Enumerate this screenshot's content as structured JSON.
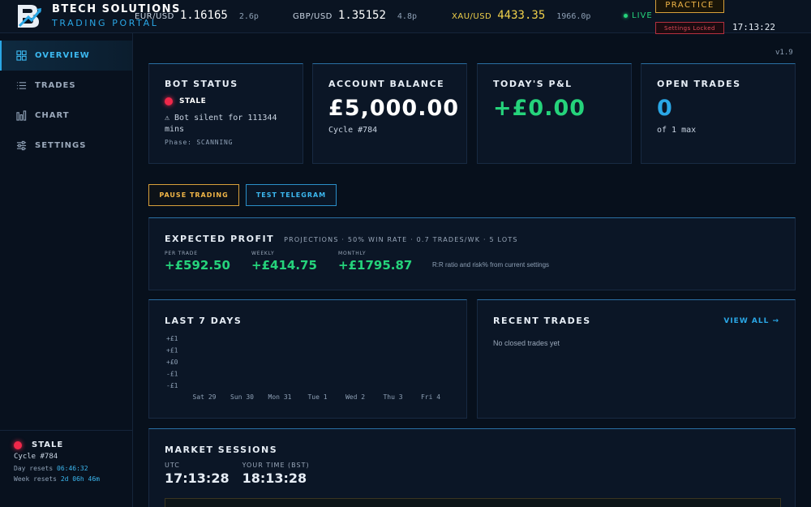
{
  "header": {
    "brand_title": "BTECH SOLUTIONS",
    "brand_sub": "TRADING PORTAL",
    "tickers": [
      {
        "pair": "EUR/USD",
        "price": "1.16165",
        "spread": "2.6p"
      },
      {
        "pair": "GBP/USD",
        "price": "1.35152",
        "spread": "4.8p"
      },
      {
        "pair": "XAU/USD",
        "price": "4433.35",
        "spread": "1966.0p"
      }
    ],
    "live_label": "LIVE",
    "mode_badge": "PRACTICE",
    "settings_badge": "Settings Locked",
    "clock": "17:13:22",
    "colors": {
      "accent": "#2aa7e6",
      "gold": "#f0d04a",
      "live": "#25d37b",
      "warning": "#d8a03a",
      "danger": "#e34b5a"
    }
  },
  "sidebar": {
    "items": [
      {
        "label": "OVERVIEW",
        "icon": "grid-icon",
        "active": true
      },
      {
        "label": "TRADES",
        "icon": "list-icon",
        "active": false
      },
      {
        "label": "CHART",
        "icon": "bar-chart-icon",
        "active": false
      },
      {
        "label": "SETTINGS",
        "icon": "sliders-icon",
        "active": false
      }
    ],
    "status": {
      "label": "STALE",
      "cycle": "Cycle #784",
      "day_reset_label": "Day resets",
      "day_reset_value": "06:46:32",
      "week_reset_label": "Week resets",
      "week_reset_value": "2d 06h 46m"
    }
  },
  "main": {
    "version": "v1.9",
    "bot_status": {
      "title": "BOT STATUS",
      "state": "STALE",
      "warning": "⚠ Bot silent for 111344 mins",
      "phase": "Phase: SCANNING"
    },
    "account_balance": {
      "title": "ACCOUNT BALANCE",
      "value": "£5,000.00",
      "sub": "Cycle #784"
    },
    "todays_pnl": {
      "title": "TODAY'S P&L",
      "value": "+£0.00"
    },
    "open_trades": {
      "title": "OPEN TRADES",
      "value": "0",
      "sub": "of 1 max"
    },
    "buttons": {
      "pause": "PAUSE TRADING",
      "telegram": "TEST TELEGRAM"
    },
    "expected_profit": {
      "title": "EXPECTED PROFIT",
      "desc": "PROJECTIONS · 50% WIN RATE · 0.7 TRADES/WK · 5 LOTS",
      "cols": [
        {
          "label": "PER TRADE",
          "value": "+£592.50"
        },
        {
          "label": "WEEKLY",
          "value": "+£414.75"
        },
        {
          "label": "MONTHLY",
          "value": "+£1795.87"
        }
      ],
      "note": "R:R ratio and risk% from current settings"
    },
    "last7": {
      "title": "LAST 7 DAYS"
    },
    "recent_trades": {
      "title": "RECENT TRADES",
      "view_all": "VIEW ALL →",
      "empty": "No closed trades yet"
    },
    "market_sessions": {
      "title": "MARKET SESSIONS",
      "utc_label": "UTC",
      "utc_time": "17:13:28",
      "local_label": "YOUR TIME (BST)",
      "local_time": "18:13:28"
    }
  },
  "chart_data": {
    "type": "bar",
    "title": "LAST 7 DAYS",
    "categories": [
      "Sat 29",
      "Sun 30",
      "Mon 31",
      "Tue 1",
      "Wed 2",
      "Thu 3",
      "Fri 4"
    ],
    "values": [
      0,
      0,
      0,
      0,
      0,
      0,
      0
    ],
    "y_tick_labels": [
      "+£1",
      "+£1",
      "+£0",
      "-£1",
      "-£1"
    ],
    "ylim": [
      -1,
      1
    ],
    "grid": false,
    "legend": "none"
  }
}
